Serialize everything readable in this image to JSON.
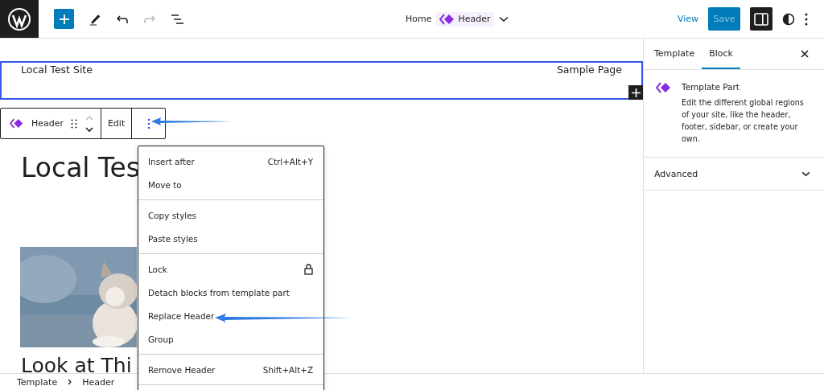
{
  "topbar": {
    "breadcrumb": {
      "home": "Home",
      "current": "Header"
    },
    "view": "View",
    "save": {
      "label": "Save",
      "disabled": true
    },
    "settings_pressed": true
  },
  "canvas": {
    "site_title": "Local Test Site",
    "nav_link": "Sample Page",
    "block_toolbar": {
      "label": "Header",
      "edit": "Edit"
    },
    "heading": "Local Tes",
    "heading_2": "Look at Thi"
  },
  "menu": {
    "groups": [
      [
        {
          "label": "Insert after",
          "kind": "shortcut",
          "shortcut": "Ctrl+Alt+Y"
        },
        {
          "label": "Move to",
          "kind": "plain"
        }
      ],
      [
        {
          "label": "Copy styles",
          "kind": "plain"
        },
        {
          "label": "Paste styles",
          "kind": "plain"
        }
      ],
      [
        {
          "label": "Lock",
          "kind": "lock"
        },
        {
          "label": "Detach blocks from template part",
          "kind": "plain"
        },
        {
          "label": "Replace Header",
          "kind": "plain"
        },
        {
          "label": "Group",
          "kind": "plain"
        }
      ],
      [
        {
          "label": "Remove Header",
          "kind": "shortcut",
          "shortcut": "Shift+Alt+Z"
        }
      ]
    ]
  },
  "sidebar": {
    "tabs": [
      {
        "label": "Template",
        "selected": false
      },
      {
        "label": "Block",
        "selected": true
      }
    ],
    "block_card": {
      "title": "Template Part",
      "description": "Edit the different global regions of your site, like the header, footer, sidebar, or create your own."
    },
    "panels": [
      {
        "label": "Advanced",
        "expanded": false
      }
    ]
  },
  "footer": {
    "breadcrumb": [
      "Template",
      "Header"
    ]
  }
}
